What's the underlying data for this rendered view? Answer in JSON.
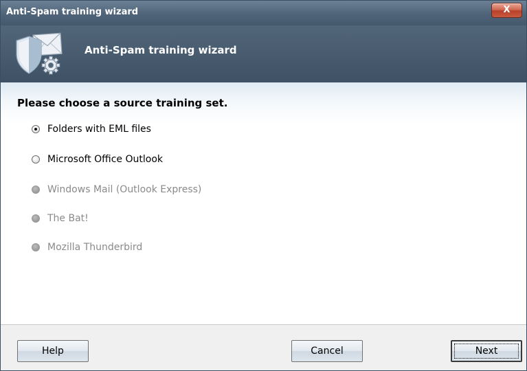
{
  "window": {
    "title": "Anti-Spam training wizard",
    "close_label": "X"
  },
  "header": {
    "title": "Anti-Spam training wizard",
    "icon": "shield-mail-gear-icon"
  },
  "content": {
    "prompt": "Please choose a source training set.",
    "options": [
      {
        "label": "Folders with EML files",
        "checked": true,
        "enabled": true
      },
      {
        "label": "Microsoft Office Outlook",
        "checked": false,
        "enabled": true
      },
      {
        "label": "Windows Mail (Outlook Express)",
        "checked": false,
        "enabled": false
      },
      {
        "label": "The Bat!",
        "checked": false,
        "enabled": false
      },
      {
        "label": "Mozilla Thunderbird",
        "checked": false,
        "enabled": false
      }
    ]
  },
  "footer": {
    "help_label": "Help",
    "cancel_label": "Cancel",
    "next_label": "Next"
  },
  "colors": {
    "title_bar": "#4f6479",
    "header": "#46596d",
    "close_button": "#c8553b"
  }
}
